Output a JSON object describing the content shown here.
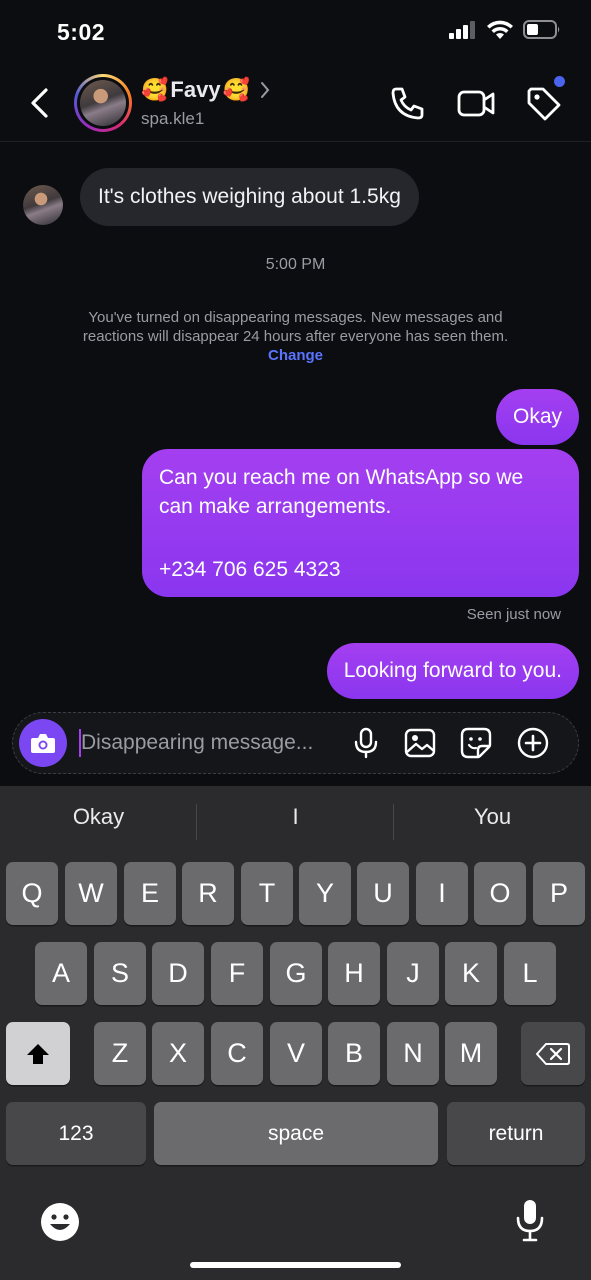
{
  "status": {
    "time": "5:02",
    "icons": [
      "cellular-signal-icon",
      "wifi-icon",
      "battery-icon"
    ]
  },
  "header": {
    "contact_name": "Favy",
    "name_emoji": "🥰",
    "username": "spa.kle1",
    "icons": [
      "back-icon",
      "chevron-right-icon",
      "phone-icon",
      "video-call-icon",
      "tag-icon"
    ]
  },
  "messages": {
    "incoming": [
      {
        "text": "It's clothes weighing about 1.5kg"
      }
    ],
    "timestamp": "5:00 PM",
    "system_note": "You've turned on disappearing messages. New messages and reactions will disappear 24 hours after everyone has seen them.",
    "system_link": "Change",
    "outgoing": [
      {
        "text": "Okay"
      },
      {
        "line1": "Can you reach me on WhatsApp so we can make arrangements.",
        "line2": "+234 706 625 4323"
      },
      {
        "text": "Looking forward to you."
      }
    ],
    "seen_status": "Seen just now"
  },
  "composer": {
    "placeholder": "Disappearing message...",
    "value": "",
    "icons": [
      "camera-icon",
      "microphone-icon",
      "gallery-icon",
      "sticker-icon",
      "plus-icon"
    ]
  },
  "keyboard": {
    "suggestions": [
      "Okay",
      "I",
      "You"
    ],
    "row1": [
      "Q",
      "W",
      "E",
      "R",
      "T",
      "Y",
      "U",
      "I",
      "O",
      "P"
    ],
    "row2": [
      "A",
      "S",
      "D",
      "F",
      "G",
      "H",
      "J",
      "K",
      "L"
    ],
    "row3": [
      "Z",
      "X",
      "C",
      "V",
      "B",
      "N",
      "M"
    ],
    "numbers_label": "123",
    "space_label": "space",
    "return_label": "return"
  },
  "colors": {
    "accent": "#8a36ef",
    "link": "#5a74ff",
    "background": "#0c0d11"
  }
}
